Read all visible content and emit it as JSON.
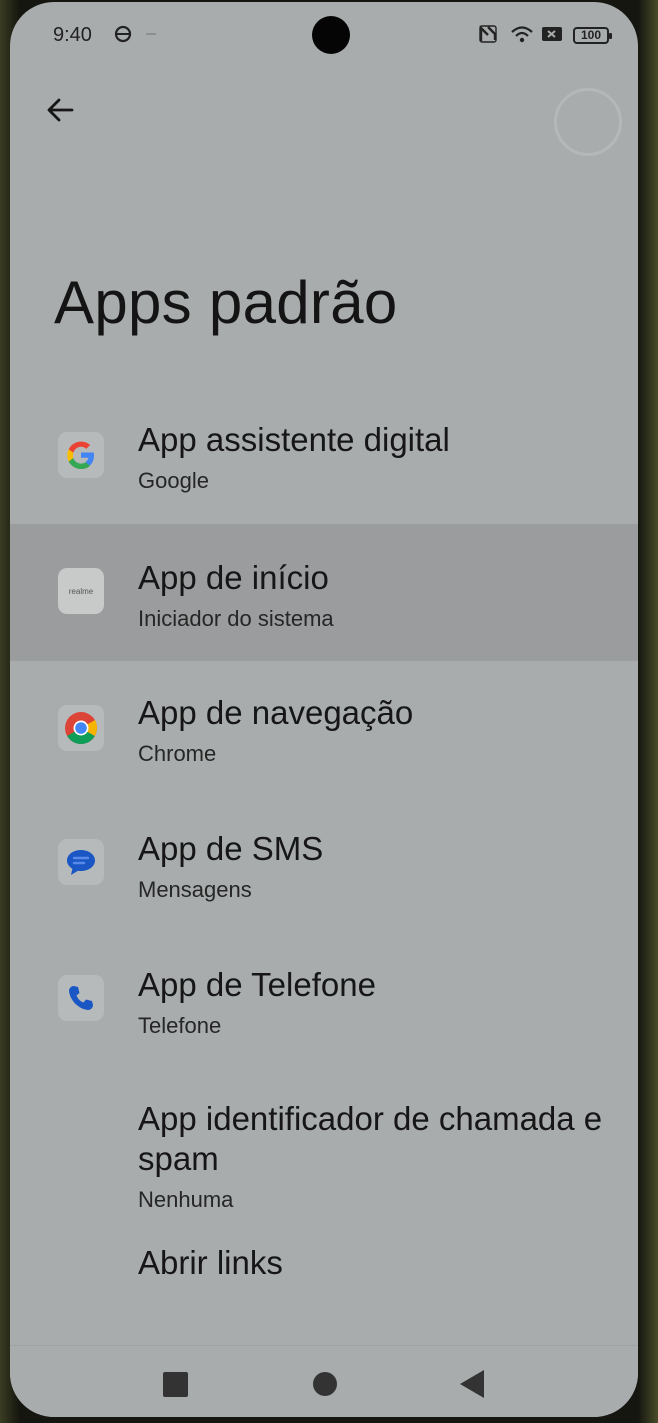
{
  "status_bar": {
    "time": "9:40",
    "battery": "100",
    "icons": [
      "sync-icon",
      "dash-icon",
      "nfc-icon",
      "wifi-icon",
      "sim-icon",
      "battery-icon"
    ]
  },
  "header": {
    "back_icon": "arrow-left-icon"
  },
  "page": {
    "title": "Apps padrão"
  },
  "items": [
    {
      "title": "App assistente digital",
      "subtitle": "Google",
      "icon": "google-icon"
    },
    {
      "title": "App de início",
      "subtitle": "Iniciador do sistema",
      "icon": "realme-launcher-icon",
      "icon_text": "realme"
    },
    {
      "title": "App de navegação",
      "subtitle": "Chrome",
      "icon": "chrome-icon"
    },
    {
      "title": "App de SMS",
      "subtitle": "Mensagens",
      "icon": "messages-icon"
    },
    {
      "title": "App de Telefone",
      "subtitle": "Telefone",
      "icon": "phone-icon"
    },
    {
      "title": "App identificador de chamada e spam",
      "subtitle": "Nenhuma"
    },
    {
      "title": "Abrir links"
    }
  ],
  "colors": {
    "screen_bg": "#a9acad",
    "highlight_bg": "#9a9c9d",
    "text": "#161616"
  },
  "nav_bar": {
    "buttons": [
      "recents-button",
      "home-button",
      "back-button"
    ]
  }
}
